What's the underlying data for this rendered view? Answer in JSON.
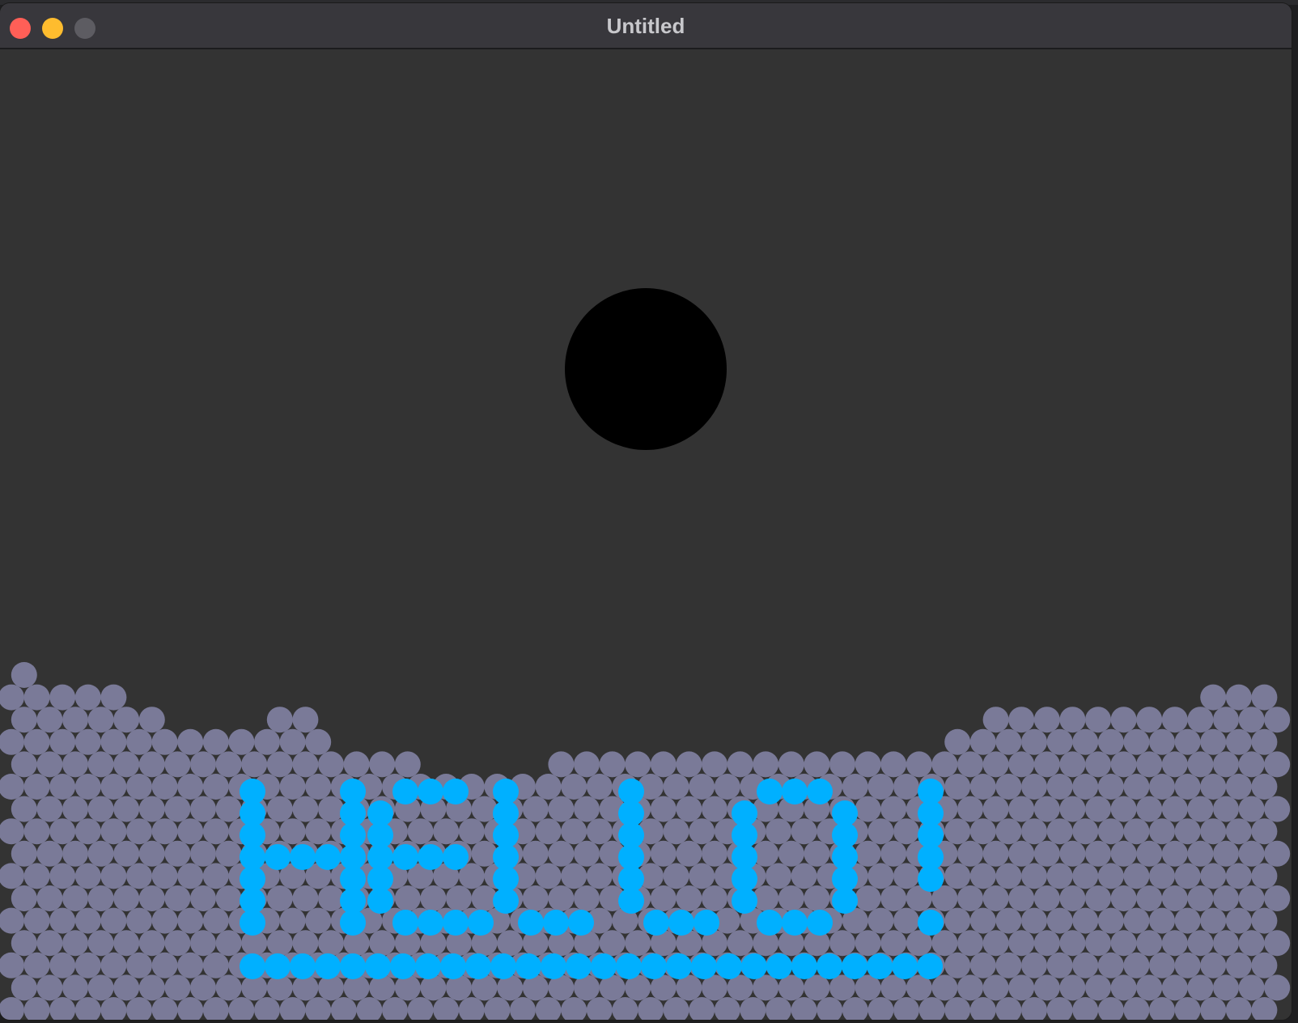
{
  "window": {
    "title": "Untitled",
    "controls": {
      "close_color": "#ff5f57",
      "minimize_color": "#febc2e",
      "zoom_color": "#5d5c62"
    }
  },
  "scene": {
    "background_color": "#333333",
    "ball_color": "#000000",
    "particle_color": "#7a7a98",
    "text_particle_color": "#00b0ff",
    "particle_text": "HELLO!"
  }
}
